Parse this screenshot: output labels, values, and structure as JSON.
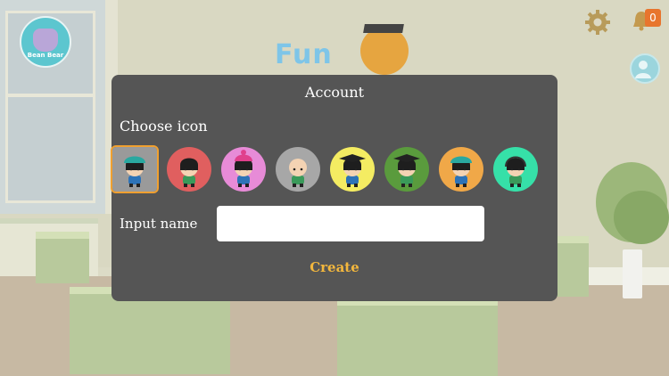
{
  "background": {
    "logo_text": "Fun",
    "avatar_label": "Bean Bear",
    "notification_count": "0"
  },
  "dialog": {
    "title": "Account",
    "choose_label": "Choose icon",
    "name_label": "Input name",
    "name_value": "",
    "create_label": "Create",
    "selected_index": 0,
    "icons": [
      {
        "name": "boy-teal-hat",
        "bg": "#9a9a9a"
      },
      {
        "name": "girl-black-hair",
        "bg": "#e05f5f"
      },
      {
        "name": "girl-pink-beanie",
        "bg": "#e78bd7"
      },
      {
        "name": "bald-kid",
        "bg": "#a7a7a7"
      },
      {
        "name": "grad-cap-yellow",
        "bg": "#f4ec62"
      },
      {
        "name": "grad-cap-green",
        "bg": "#5a9b3d"
      },
      {
        "name": "boy-teal-hat-orange",
        "bg": "#f0a848"
      },
      {
        "name": "kid-headphones",
        "bg": "#36e0a8"
      }
    ]
  },
  "colors": {
    "dialog_bg": "#555555",
    "accent": "#f3b73d",
    "selected_outline": "#f0a030"
  }
}
